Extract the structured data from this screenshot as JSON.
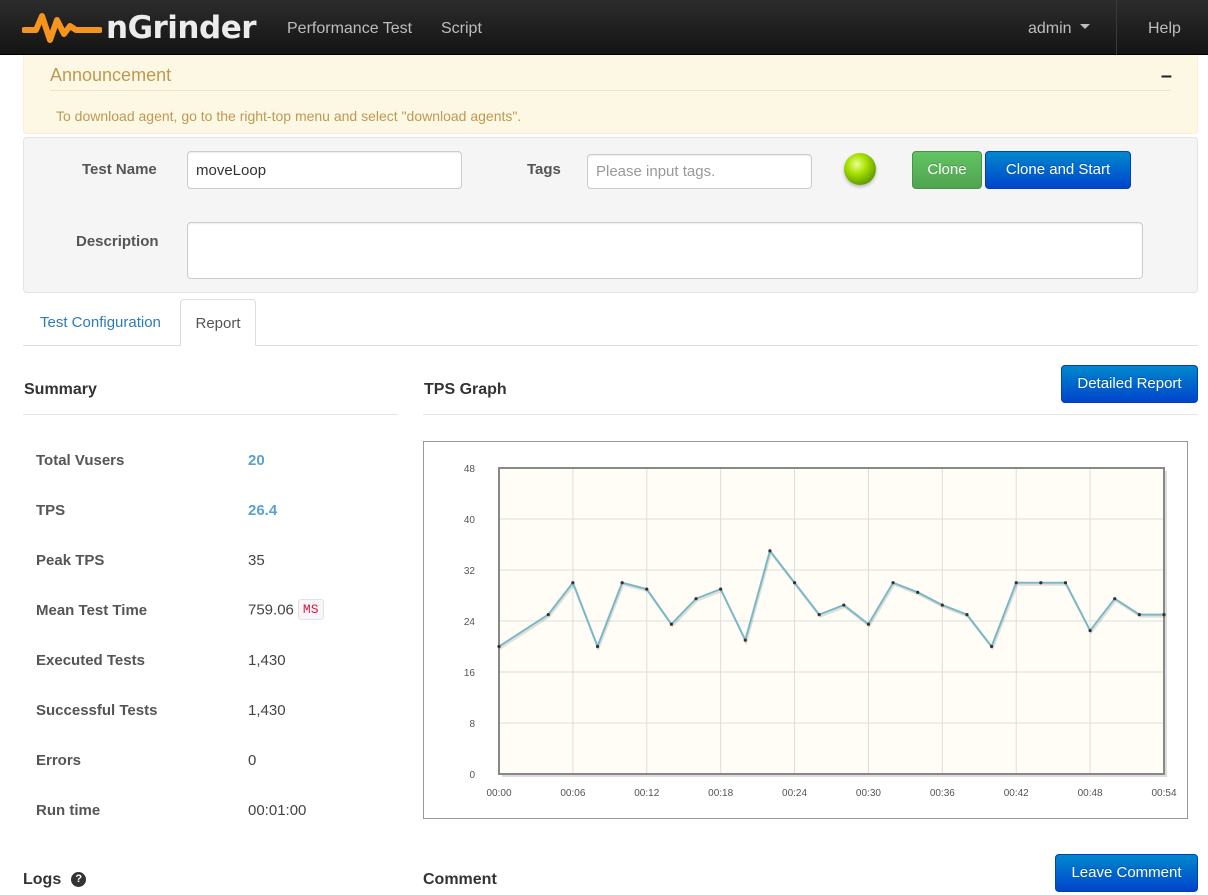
{
  "navbar": {
    "brand": "nGrinder",
    "links": {
      "performance_test": "Performance Test",
      "script": "Script"
    },
    "user": "admin",
    "help": "Help"
  },
  "announcement": {
    "title": "Announcement",
    "minimize": "–",
    "text": "To download agent, go to the right-top menu and select \"download agents\"."
  },
  "form": {
    "test_name_label": "Test Name",
    "test_name_value": "moveLoop",
    "tags_label": "Tags",
    "tags_placeholder": "Please input tags.",
    "description_label": "Description",
    "description_value": "",
    "status_color": "#a6e000",
    "clone_button": "Clone",
    "clone_start_button": "Clone and Start"
  },
  "tabs": {
    "config": "Test Configuration",
    "report": "Report"
  },
  "summary": {
    "title": "Summary",
    "rows": [
      {
        "label": "Total Vusers",
        "value": "20"
      },
      {
        "label": "TPS",
        "value": "26.4"
      },
      {
        "label": "Peak TPS",
        "value": "35"
      },
      {
        "label": "Mean Test Time",
        "value": "759.06",
        "unit": "MS"
      },
      {
        "label": "Executed Tests",
        "value": "1,430"
      },
      {
        "label": "Successful Tests",
        "value": "1,430"
      },
      {
        "label": "Errors",
        "value": "0"
      },
      {
        "label": "Run time",
        "value": "00:01:00"
      }
    ]
  },
  "graph": {
    "title": "TPS Graph",
    "detailed_report_button": "Detailed Report"
  },
  "chart_data": {
    "type": "line",
    "title": "",
    "xlabel": "",
    "ylabel": "",
    "x_ticks": [
      "00:00",
      "00:06",
      "00:12",
      "00:18",
      "00:24",
      "00:30",
      "00:36",
      "00:42",
      "00:48",
      "00:54"
    ],
    "y_ticks": [
      "0",
      "8",
      "16",
      "24",
      "32",
      "40",
      "48"
    ],
    "ylim": [
      0,
      48
    ],
    "xlim": [
      0,
      54
    ],
    "grid": true,
    "series": [
      {
        "color": "#7ab8c8",
        "x": [
          0,
          4,
          6,
          8,
          10,
          12,
          14,
          16,
          18,
          20,
          22,
          24,
          26,
          28,
          30,
          32,
          34,
          36,
          38,
          40,
          42,
          44,
          46,
          48,
          50,
          52,
          54
        ],
        "y": [
          20,
          25,
          30,
          20,
          30,
          29,
          23.5,
          27.5,
          29,
          21,
          35,
          30,
          25,
          26.5,
          23.5,
          30,
          28.5,
          26.5,
          25,
          20,
          30,
          30,
          30,
          22.5,
          27.5,
          25,
          25
        ]
      }
    ]
  },
  "logs": {
    "title": "Logs",
    "help": "?"
  },
  "comment": {
    "title": "Comment",
    "leave_comment_button": "Leave Comment"
  }
}
